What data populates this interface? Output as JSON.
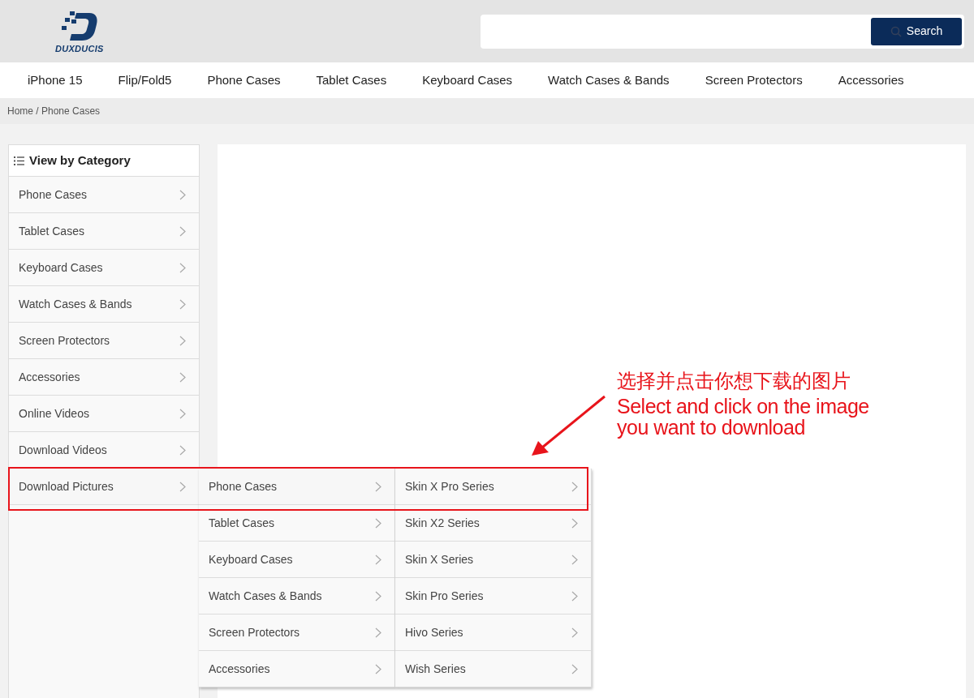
{
  "header": {
    "logo_text": "DUXDUCIS",
    "search": {
      "button": "Search"
    }
  },
  "nav": [
    "iPhone 15",
    "Flip/Fold5",
    "Phone Cases",
    "Tablet Cases",
    "Keyboard Cases",
    "Watch Cases & Bands",
    "Screen Protectors",
    "Accessories"
  ],
  "breadcrumb": "Home / Phone Cases",
  "sidebar": {
    "title": "View by Category",
    "items": [
      {
        "label": "Phone Cases"
      },
      {
        "label": "Tablet Cases"
      },
      {
        "label": "Keyboard Cases"
      },
      {
        "label": "Watch Cases & Bands"
      },
      {
        "label": "Screen Protectors"
      },
      {
        "label": "Accessories"
      },
      {
        "label": "Online Videos"
      },
      {
        "label": "Download Videos"
      },
      {
        "label": "Download Pictures",
        "expanded": true,
        "children": [
          {
            "label": "Phone Cases",
            "expanded": true,
            "children": [
              {
                "label": "Skin X Pro Series"
              },
              {
                "label": "Skin X2 Series"
              },
              {
                "label": "Skin X Series"
              },
              {
                "label": "Skin Pro Series"
              },
              {
                "label": "Hivo Series"
              },
              {
                "label": "Wish Series"
              }
            ]
          },
          {
            "label": "Tablet Cases"
          },
          {
            "label": "Keyboard Cases"
          },
          {
            "label": "Watch Cases & Bands"
          },
          {
            "label": "Screen Protectors"
          },
          {
            "label": "Accessories"
          }
        ]
      }
    ]
  },
  "annotation": {
    "title": "选择并点击你想下载的图片",
    "lines": [
      "Select and click on the image",
      "you want to download"
    ]
  }
}
